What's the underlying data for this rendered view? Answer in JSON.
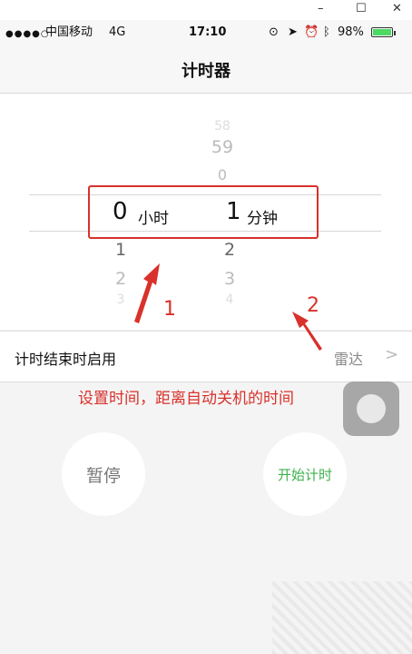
{
  "window": {
    "minimize": "–",
    "maximize": "☐",
    "close": "✕"
  },
  "status_bar": {
    "signal": "●●●●○",
    "carrier": "中国移动",
    "network": "4G",
    "time": "17:10",
    "icons": [
      "orientation-lock-icon",
      "location-icon",
      "alarm-icon",
      "bluetooth-icon"
    ],
    "battery": "98%",
    "battery_level": 0.98,
    "accent": "#4cd964"
  },
  "nav": {
    "title": "计时器"
  },
  "picker": {
    "hours": {
      "above": [],
      "selected": "0",
      "below": [
        "1",
        "2",
        "3"
      ],
      "unit": "小时"
    },
    "minutes": {
      "above": [
        "58",
        "59",
        "0"
      ],
      "selected": "1",
      "below": [
        "2",
        "3",
        "4"
      ],
      "unit": "分钟"
    }
  },
  "end_row": {
    "label": "计时结束时启用",
    "value": "雷达",
    "chevron": ">"
  },
  "annotations": {
    "text": "设置时间，距离自动关机的时间",
    "marker1": "1",
    "marker2": "2",
    "color": "#d9312b"
  },
  "buttons": {
    "pause": "暂停",
    "start": "开始计时",
    "start_color": "#3db24b"
  }
}
